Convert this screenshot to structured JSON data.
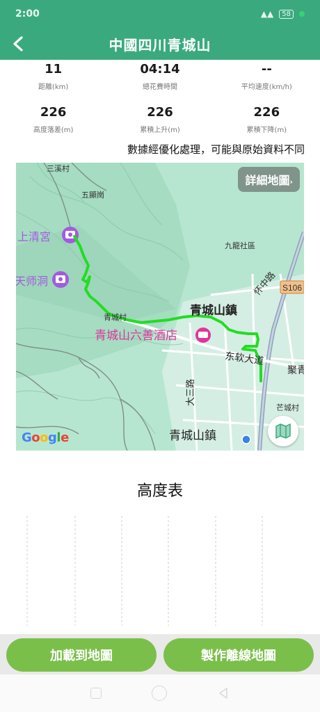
{
  "status_bar": {
    "time": "2:00",
    "battery": "58"
  },
  "header": {
    "title": "中國四川青城山"
  },
  "stats": {
    "row1": [
      {
        "value": "11",
        "label": "距離(km)"
      },
      {
        "value": "04:14",
        "label": "總花費時間"
      },
      {
        "value": "--",
        "label": "平均速度(km/h)"
      }
    ],
    "row2": [
      {
        "value": "226",
        "label": "高度落差(m)"
      },
      {
        "value": "226",
        "label": "累積上升(m)"
      },
      {
        "value": "226",
        "label": "累積下降(m)"
      }
    ]
  },
  "note": "數據經優化處理，可能與原始資料不同",
  "map": {
    "detail_button": "詳細地圖",
    "provider": "Google",
    "labels": {
      "sanxi": "三溪村",
      "wuxian": "五顯崗",
      "shangqing": "上清宮",
      "tianshi": "天师洞",
      "jiulong": "九龍社區",
      "huaizhong": "怀中路",
      "s106": "S106",
      "qingcheng_cun": "青城村",
      "qingcheng_town": "青城山鎮",
      "hotel": "青城山六善酒店",
      "dongruan": "东软大道",
      "juqing": "聚青",
      "dasan": "大三路",
      "mangcheng": "芒城村",
      "qingcheng_town2": "青城山鎮"
    },
    "route_color": "#22dd22",
    "poi_color": "#a25be0",
    "hotel_color": "#e0359a"
  },
  "altitude": {
    "title": "高度表"
  },
  "buttons": {
    "load_to_map": "加載到地圖",
    "make_offline": "製作離線地圖"
  },
  "colors": {
    "accent": "#3aaa7e",
    "button": "#7bbf4b"
  }
}
